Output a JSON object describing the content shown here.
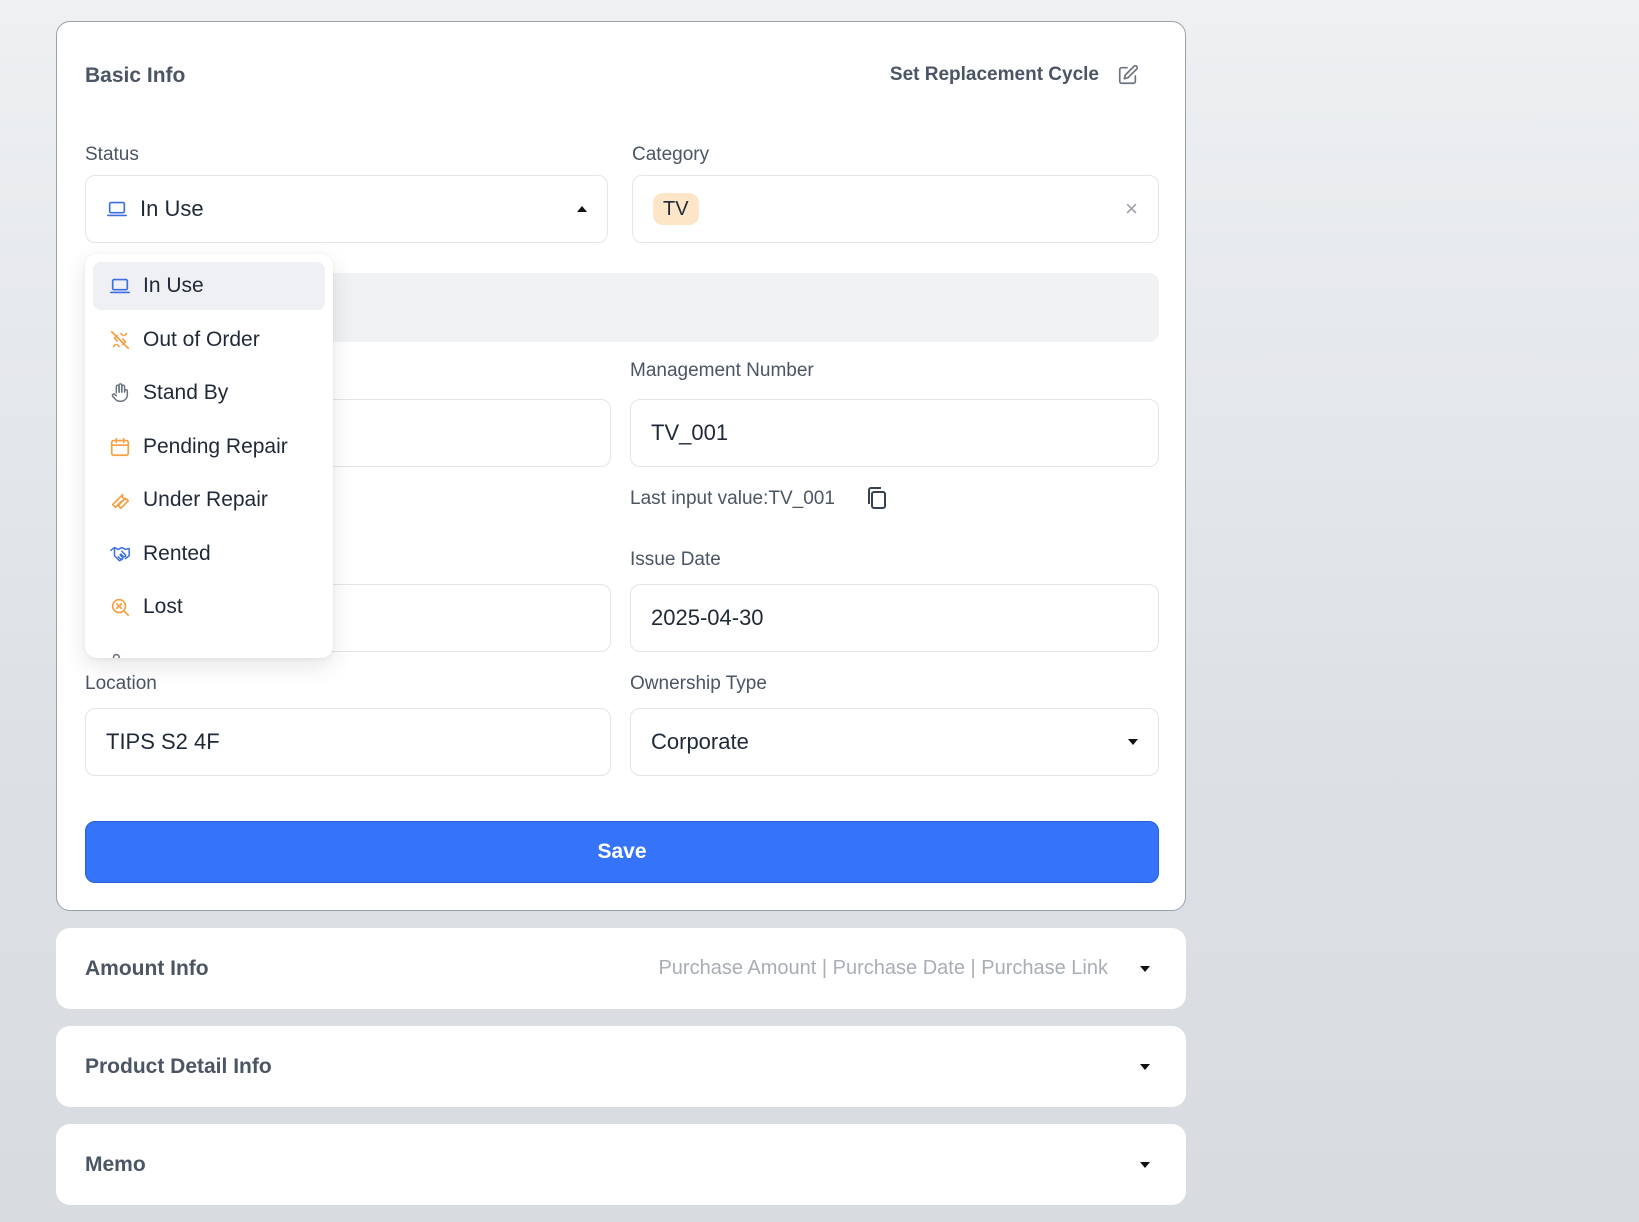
{
  "basic_info": {
    "title": "Basic Info",
    "replacement_cycle_label": "Set Replacement Cycle",
    "status": {
      "label": "Status",
      "value": "In Use"
    },
    "category": {
      "label": "Category",
      "chip": "TV",
      "clear": "×"
    },
    "management_number": {
      "label": "Management Number",
      "value": "TV_001"
    },
    "last_input": {
      "text": "Last input value:TV_001"
    },
    "issue_date": {
      "label": "Issue Date",
      "value": "2025-04-30"
    },
    "location": {
      "label": "Location",
      "value": "TIPS S2 4F"
    },
    "ownership_type": {
      "label": "Ownership Type",
      "value": "Corporate"
    },
    "save_label": "Save"
  },
  "status_dropdown": {
    "options": [
      {
        "label": "In Use",
        "icon": "laptop-icon",
        "color": "#3b6fe0"
      },
      {
        "label": "Out of Order",
        "icon": "broken-plug-icon",
        "color": "#f59e42"
      },
      {
        "label": "Stand By",
        "icon": "hand-icon",
        "color": "#6b7280"
      },
      {
        "label": "Pending Repair",
        "icon": "calendar-icon",
        "color": "#f59e42"
      },
      {
        "label": "Under Repair",
        "icon": "wrench-icon",
        "color": "#f59e42"
      },
      {
        "label": "Rented",
        "icon": "handshake-icon",
        "color": "#3b6fe0"
      },
      {
        "label": "Lost",
        "icon": "search-x-icon",
        "color": "#f59e42"
      }
    ]
  },
  "accordions": {
    "amount": {
      "title": "Amount Info",
      "subtitle": "Purchase Amount | Purchase Date | Purchase Link"
    },
    "product_detail": {
      "title": "Product Detail Info"
    },
    "memo": {
      "title": "Memo"
    }
  },
  "colors": {
    "accent": "#3574f9",
    "chip_bg": "#fde6c8",
    "icon_orange": "#f59e42",
    "icon_blue": "#3b6fe0"
  }
}
